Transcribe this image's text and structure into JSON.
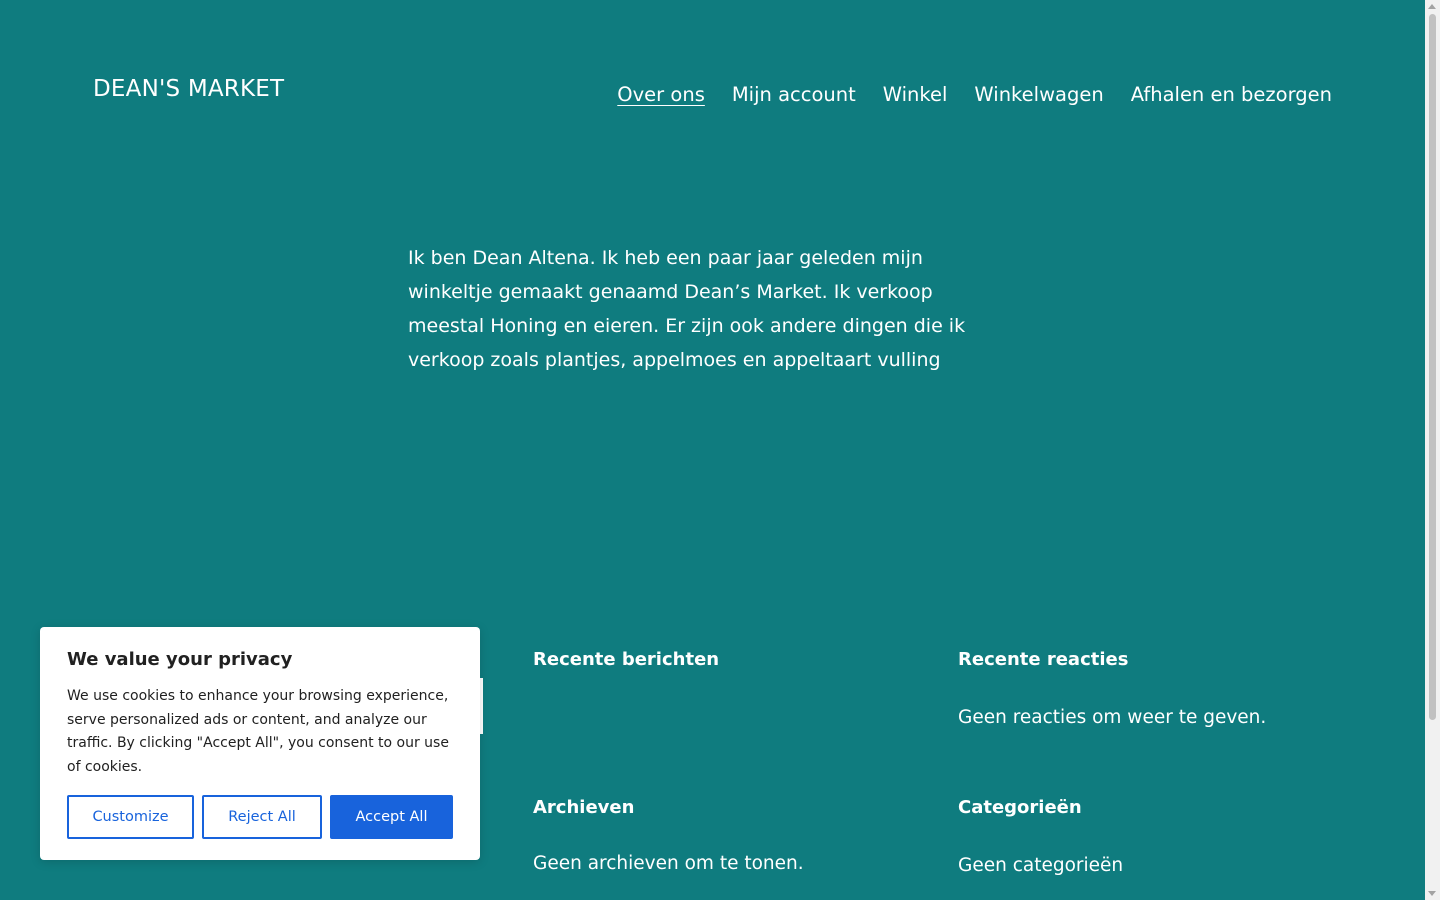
{
  "site": {
    "title": "DEAN'S MARKET"
  },
  "nav": {
    "items": [
      {
        "label": "Over ons",
        "current": true
      },
      {
        "label": "Mijn account"
      },
      {
        "label": "Winkel"
      },
      {
        "label": "Winkelwagen"
      },
      {
        "label": "Afhalen en bezorgen"
      }
    ]
  },
  "intro": {
    "line1": "Ik ben Dean Altena. Ik heb een paar jaar geleden mijn",
    "line2": "winkeltje gemaakt genaamd Dean’s Market. Ik verkoop",
    "line3": "meestal Honing en eieren. Er zijn ook andere dingen die ik",
    "line4": "verkoop zoals plantjes, appelmoes en appeltaart vulling"
  },
  "widgets": {
    "recent_posts": {
      "title": "Recente berichten"
    },
    "recent_comments": {
      "title": "Recente reacties",
      "text": "Geen reacties om weer te geven."
    },
    "archives": {
      "title": "Archieven",
      "text": "Geen archieven om te tonen."
    },
    "categories": {
      "title": "Categorieën",
      "text": "Geen categorieën"
    }
  },
  "cookie_banner": {
    "title": "We value your privacy",
    "body": "We use cookies to enhance your browsing experience, serve personalized ads or content, and analyze our traffic. By clicking \"Accept All\", you consent to our use of cookies.",
    "customize_label": "Customize",
    "reject_label": "Reject All",
    "accept_label": "Accept All"
  },
  "colors": {
    "background": "#0f7c7f",
    "text": "#ffffff",
    "button_primary": "#1863dc"
  }
}
